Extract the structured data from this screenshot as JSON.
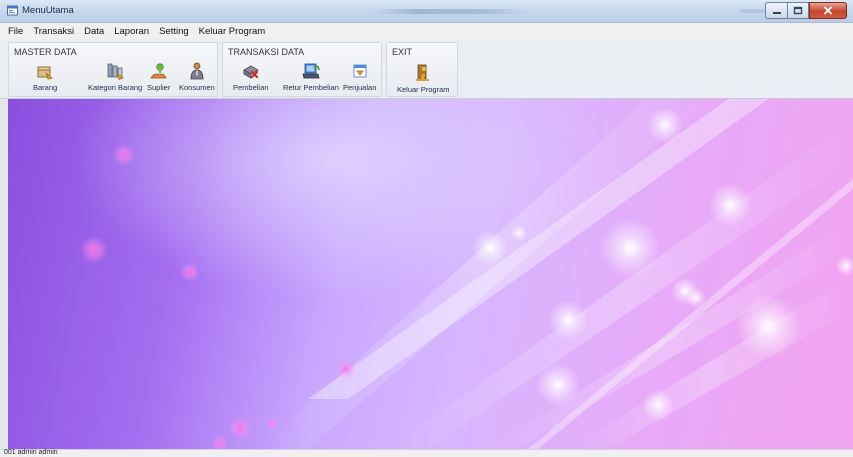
{
  "window": {
    "title": "MenuUtama",
    "icon": "form-app-icon",
    "controls": [
      "minimize-icon",
      "maximize-icon",
      "close-icon"
    ]
  },
  "menu": {
    "items": [
      {
        "label": "File"
      },
      {
        "label": "Transaksi"
      },
      {
        "label": "Data"
      },
      {
        "label": "Laporan"
      },
      {
        "label": "Setting"
      },
      {
        "label": "Keluar Program"
      }
    ]
  },
  "ribbon": {
    "groups": [
      {
        "title": "MASTER DATA",
        "buttons": [
          {
            "label": "Barang",
            "icon": "box-icon"
          },
          {
            "label": "Kategori Barang",
            "icon": "category-icon"
          },
          {
            "label": "Suplier",
            "icon": "supplier-icon"
          },
          {
            "label": "Konsumen",
            "icon": "customer-icon"
          }
        ]
      },
      {
        "title": "TRANSAKSI DATA",
        "buttons": [
          {
            "label": "Pembelian",
            "icon": "purchase-icon"
          },
          {
            "label": "Retur Pembelian",
            "icon": "return-icon"
          },
          {
            "label": "Penjualan",
            "icon": "sales-icon"
          }
        ]
      },
      {
        "title": "EXIT",
        "buttons": [
          {
            "label": "Keluar Program",
            "icon": "exit-icon"
          }
        ]
      }
    ]
  },
  "status": {
    "text": "001 admin admin"
  },
  "colors": {
    "bg_start": "#8a4fe0",
    "bg_mid": "#d7b6ff",
    "bg_end": "#f2a3ef",
    "titlebar": "#c7d9ee",
    "close_button": "#c8462c"
  }
}
